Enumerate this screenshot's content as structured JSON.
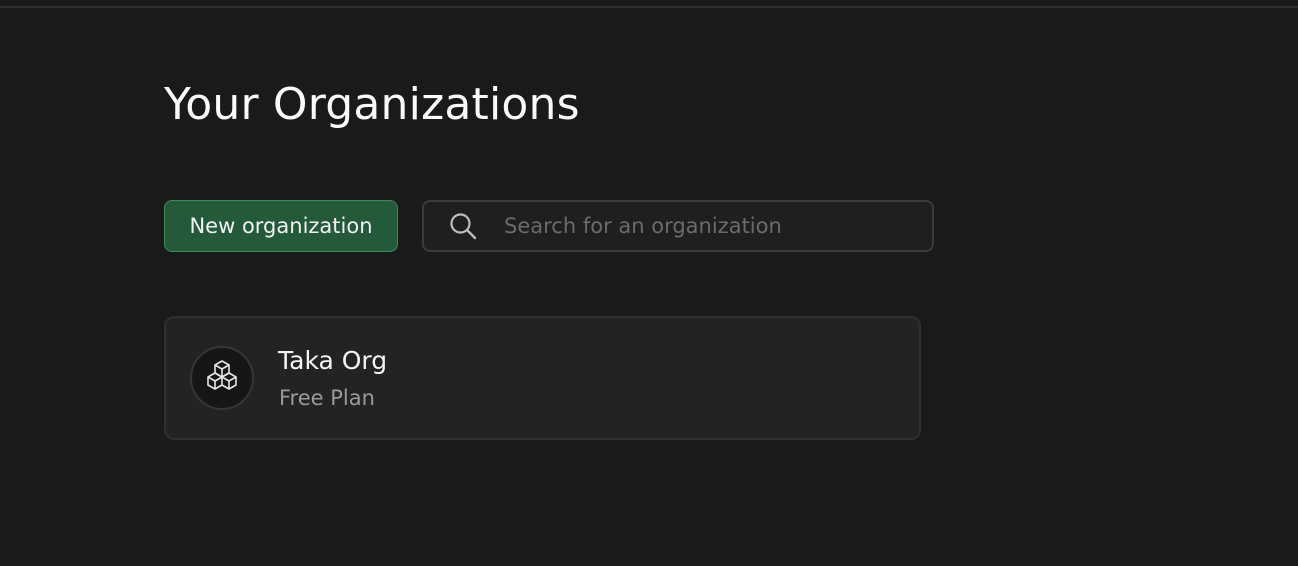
{
  "page": {
    "title": "Your Organizations"
  },
  "toolbar": {
    "new_org_label": "New organization",
    "search_placeholder": "Search for an organization",
    "search_value": "",
    "search_icon": "search-icon"
  },
  "organizations": [
    {
      "name": "Taka Org",
      "plan": "Free Plan",
      "icon": "cubes-icon"
    }
  ],
  "colors": {
    "background": "#1a1a1a",
    "primary_button": "#24593a",
    "primary_button_border": "#3f8a5a",
    "card_background": "#232323",
    "muted_text": "#9a9a9a"
  }
}
